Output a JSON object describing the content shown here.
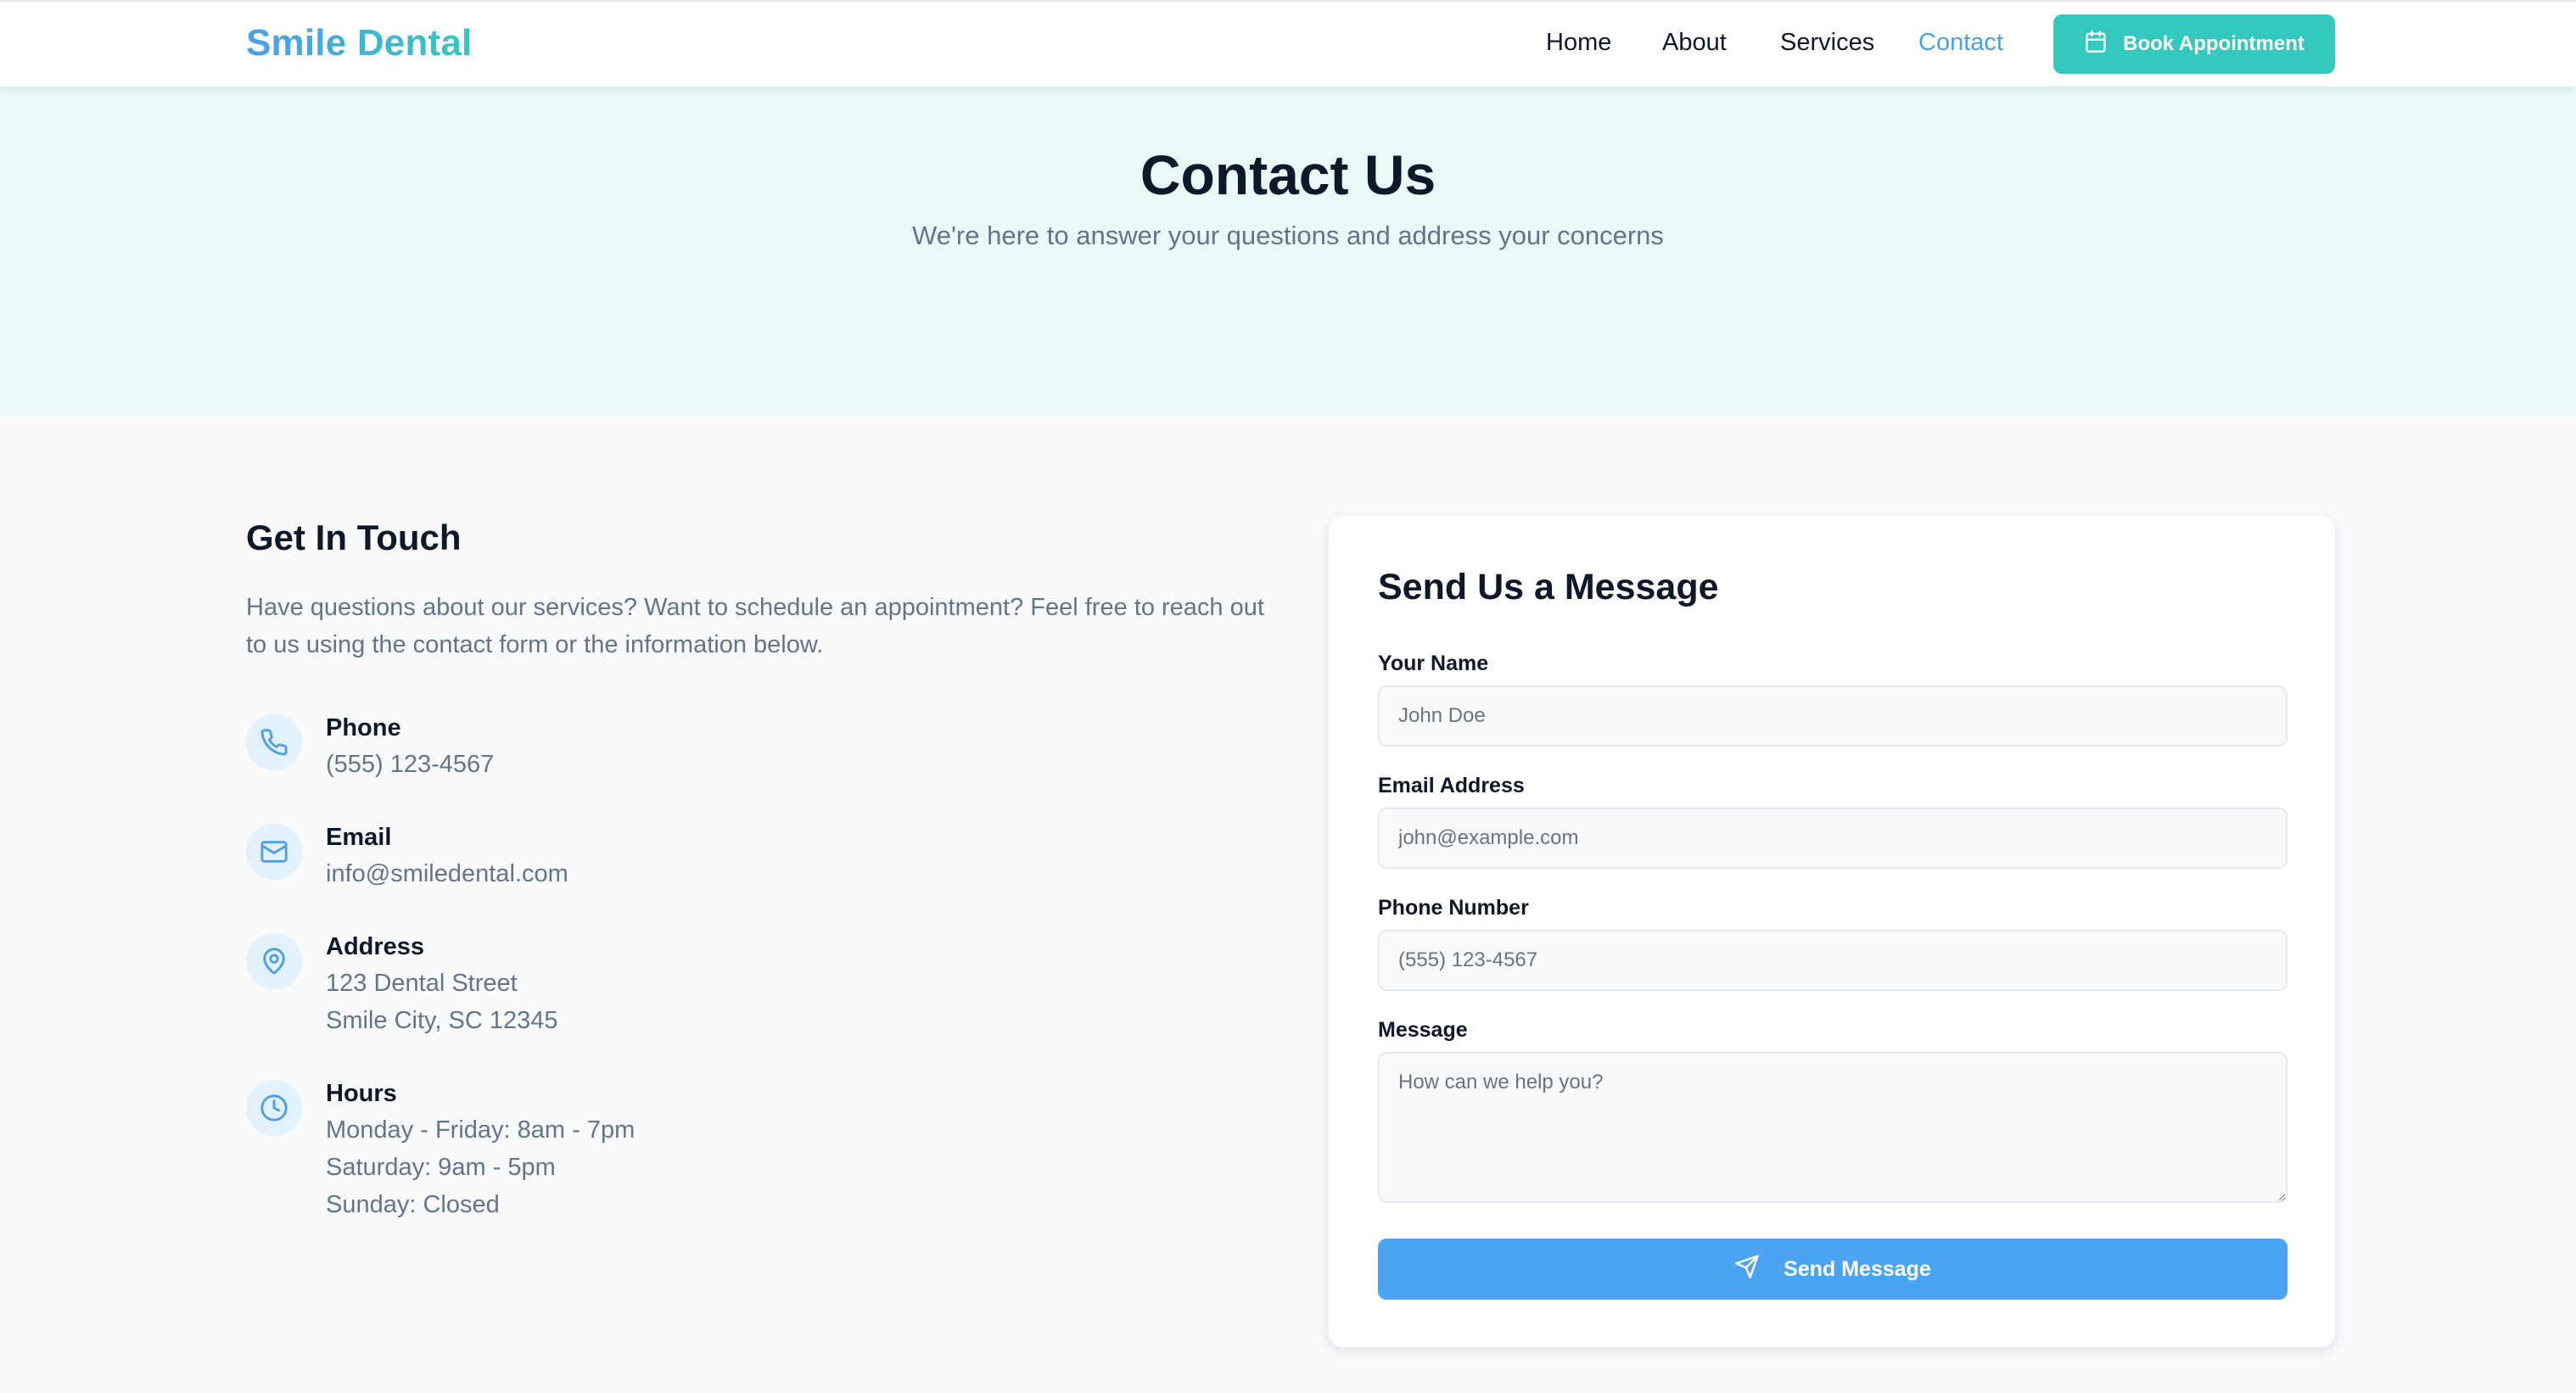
{
  "header": {
    "logo": "Smile Dental",
    "nav": [
      "Home",
      "About",
      "Services",
      "Contact"
    ],
    "active_nav": "Contact",
    "book_label": "Book Appointment"
  },
  "hero": {
    "title": "Contact Us",
    "subtitle": "We're here to answer your questions and address your concerns"
  },
  "touch": {
    "title": "Get In Touch",
    "description": "Have questions about our services? Want to schedule an appointment? Feel free to reach out to us using the contact form or the information below.",
    "items": [
      {
        "icon": "phone-icon",
        "label": "Phone",
        "lines": [
          "(555) 123-4567"
        ]
      },
      {
        "icon": "mail-icon",
        "label": "Email",
        "lines": [
          "info@smiledental.com"
        ]
      },
      {
        "icon": "map-pin-icon",
        "label": "Address",
        "lines": [
          "123 Dental Street",
          "Smile City, SC 12345"
        ]
      },
      {
        "icon": "clock-icon",
        "label": "Hours",
        "lines": [
          "Monday - Friday: 8am - 7pm",
          "Saturday: 9am - 5pm",
          "Sunday: Closed"
        ]
      }
    ]
  },
  "form": {
    "title": "Send Us a Message",
    "name_label": "Your Name",
    "name_placeholder": "John Doe",
    "email_label": "Email Address",
    "email_placeholder": "john@example.com",
    "phone_label": "Phone Number",
    "phone_placeholder": "(555) 123-4567",
    "message_label": "Message",
    "message_placeholder": "How can we help you?",
    "send_label": "Send Message"
  },
  "colors": {
    "primary": "#4aa3f3",
    "accent": "#34c8bf",
    "hero_bg": "#ebf8f7",
    "text_muted": "#64748b"
  }
}
